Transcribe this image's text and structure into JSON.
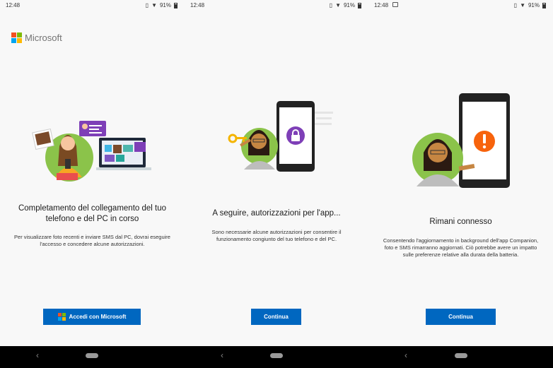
{
  "colors": {
    "accent": "#0067c0",
    "ms_red": "#f25022",
    "ms_green": "#7fba00",
    "ms_blue": "#00a4ef",
    "ms_yellow": "#ffb900",
    "purple": "#7e3fb7",
    "orange": "#f7630c",
    "green_circle": "#8bc34a"
  },
  "screens": [
    {
      "status": {
        "time": "12:48",
        "battery": "91%"
      },
      "logo": "Microsoft",
      "title": "Completamento del collegamento del tuo telefono e del PC in corso",
      "body": "Per visualizzare foto recenti e inviare SMS dal PC, dovrai eseguire l'accesso e concedere alcune autorizzazioni.",
      "button": "Accedi con Microsoft"
    },
    {
      "status": {
        "time": "12:48",
        "battery": "91%"
      },
      "title": "A seguire, autorizzazioni per l'app...",
      "body": "Sono necessarie alcune autorizzazioni per consentire il funzionamento congiunto del tuo telefono e del PC.",
      "button": "Continua"
    },
    {
      "status": {
        "time": "12:48",
        "battery": "91%"
      },
      "title": "Rimani connesso",
      "body": "Consentendo l'aggiornamento in background dell'app Companion, foto e SMS rimarranno aggiornati. Ciò potrebbe avere un impatto sulle preferenze relative alla durata della batteria.",
      "button": "Continua"
    }
  ],
  "icons": {
    "vibrate": "vibrate-icon",
    "wifi": "wifi-icon",
    "battery": "battery-icon",
    "image": "image-notification-icon",
    "lock": "lock-icon",
    "key": "key-icon",
    "alert": "exclamation-icon",
    "back": "back-icon",
    "home": "home-pill-icon"
  }
}
